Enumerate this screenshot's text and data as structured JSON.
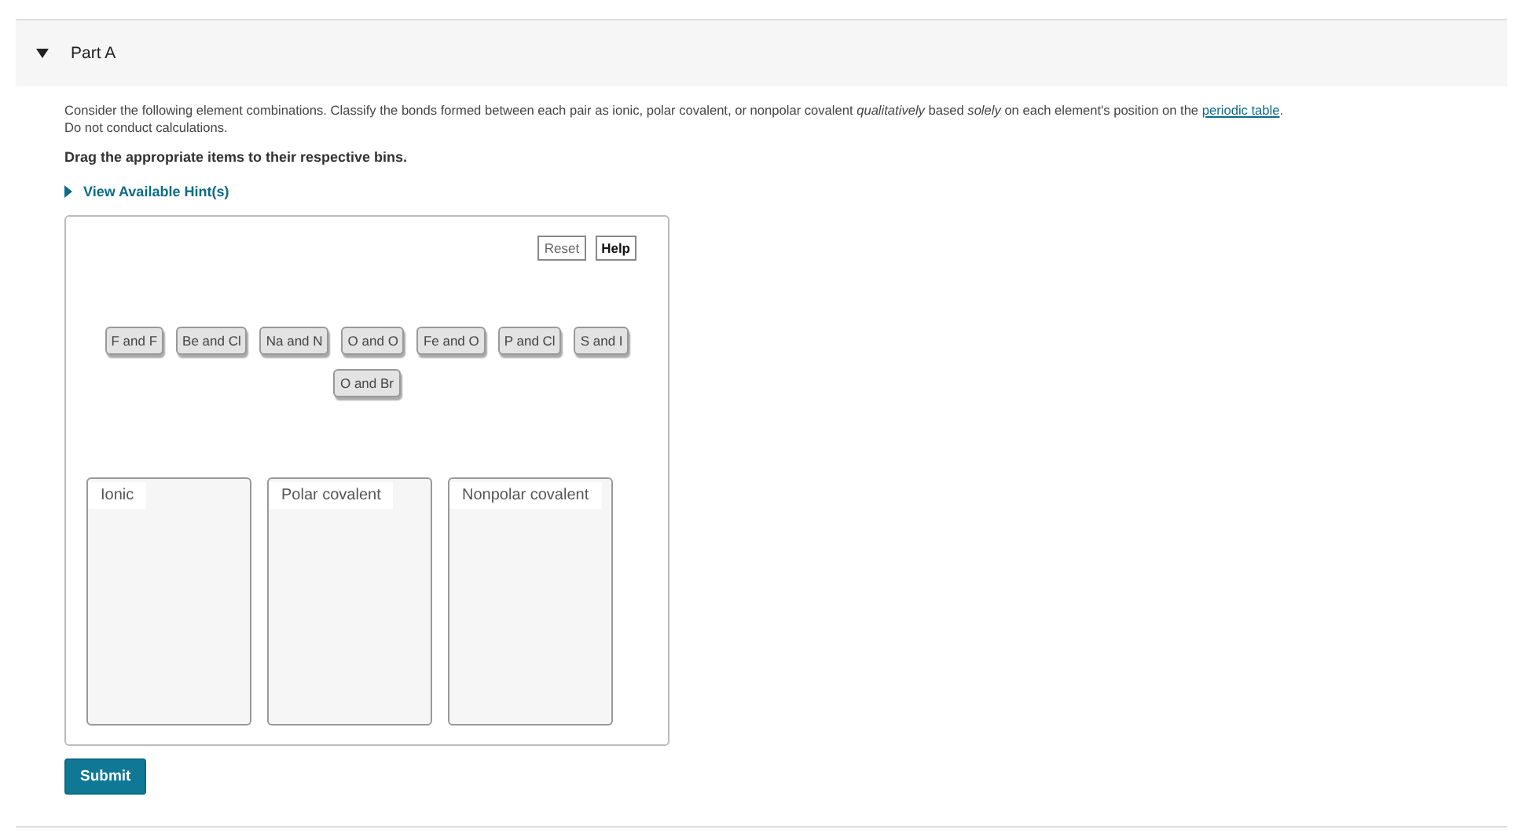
{
  "part": {
    "title": "Part A",
    "expanded": true
  },
  "prompt": {
    "text": "Consider the following element combinations. Classify the bonds formed between each pair as ionic, polar covalent, or nonpolar covalent *qualitatively* based *solely* on each element's position on the",
    "link": "periodic table",
    "end": "."
  },
  "note": "Do not conduct calculations.",
  "instruction": "Drag the appropriate items to their respective bins.",
  "hint": {
    "label": "View Available Hint(s)",
    "expanded": false
  },
  "toolbar": [
    "Reset",
    "Help"
  ],
  "items": [
    "F and F",
    "Be and Cl",
    "Na and N",
    "O and O",
    "Fe and O",
    "P and Cl",
    "S and I",
    "O and Br"
  ],
  "bins": [
    "Ionic",
    "Polar covalent",
    "Nonpolar covalent"
  ],
  "submit": "Submit"
}
